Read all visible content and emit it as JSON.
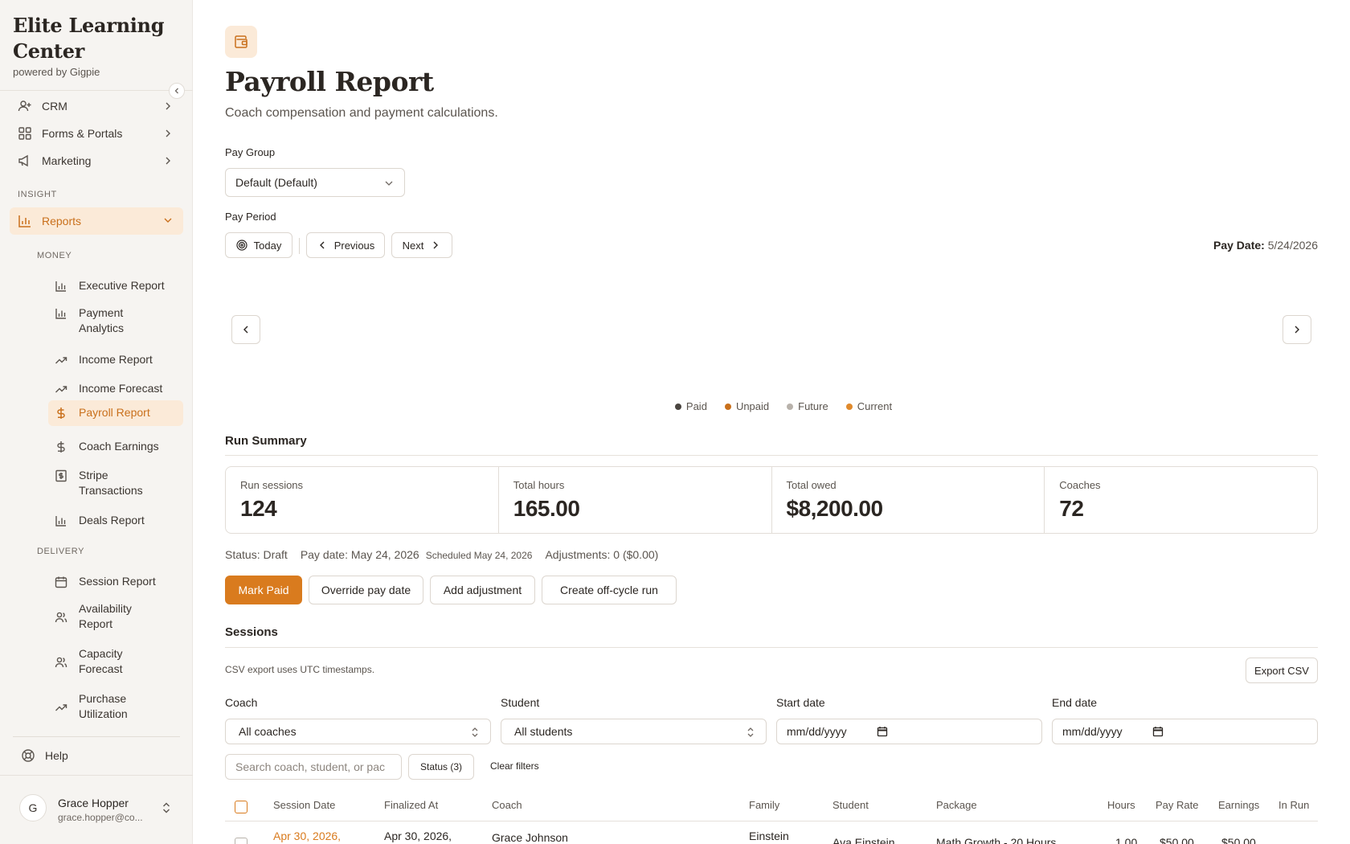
{
  "brand": {
    "title": "Elite Learning Center",
    "subtitle": "powered by Gigpie"
  },
  "nav": {
    "crm": "CRM",
    "forms": "Forms & Portals",
    "marketing": "Marketing",
    "insight_label": "INSIGHT",
    "reports": "Reports",
    "money_label": "MONEY",
    "money_items": [
      "Executive Report",
      "Payment Analytics",
      "Income Report",
      "Income Forecast",
      "Payroll Report",
      "Coach Earnings",
      "Stripe Transactions",
      "Deals Report"
    ],
    "delivery_label": "DELIVERY",
    "delivery_items": [
      "Session Report",
      "Availability Report",
      "Capacity Forecast",
      "Purchase Utilization"
    ],
    "help": "Help"
  },
  "user": {
    "initial": "G",
    "name": "Grace Hopper",
    "email": "grace.hopper@co..."
  },
  "header": {
    "title": "Payroll Report",
    "subtitle": "Coach compensation and payment calculations."
  },
  "pay_group": {
    "label": "Pay Group",
    "value": "Default (Default)"
  },
  "pay_period": {
    "label": "Pay Period",
    "today": "Today",
    "previous": "Previous",
    "next": "Next",
    "pay_date_label": "Pay Date:",
    "pay_date_value": "5/24/2026"
  },
  "legend": [
    {
      "label": "Paid",
      "color": "#4a4540"
    },
    {
      "label": "Unpaid",
      "color": "#c9701c"
    },
    {
      "label": "Future",
      "color": "#b8b2ab"
    },
    {
      "label": "Current",
      "color": "#e08a2c"
    }
  ],
  "run_summary": {
    "title": "Run Summary",
    "stats": [
      {
        "label": "Run sessions",
        "value": "124"
      },
      {
        "label": "Total hours",
        "value": "165.00"
      },
      {
        "label": "Total owed",
        "value": "$8,200.00"
      },
      {
        "label": "Coaches",
        "value": "72"
      }
    ],
    "status": "Status: Draft",
    "pay_date": "Pay date: May 24, 2026",
    "scheduled": "Scheduled May 24, 2026",
    "adjustments": "Adjustments: 0 ($0.00)",
    "actions": {
      "mark_paid": "Mark Paid",
      "override": "Override pay date",
      "add_adjustment": "Add adjustment",
      "off_cycle": "Create off-cycle run"
    }
  },
  "sessions": {
    "title": "Sessions",
    "csv_note": "CSV export uses UTC timestamps.",
    "export": "Export CSV",
    "filters": {
      "coach_label": "Coach",
      "coach_value": "All coaches",
      "student_label": "Student",
      "student_value": "All students",
      "start_label": "Start date",
      "start_placeholder": "mm/dd/yyyy",
      "end_label": "End date",
      "end_placeholder": "mm/dd/yyyy",
      "search_placeholder": "Search coach, student, or pac",
      "status": "Status (3)",
      "clear": "Clear filters"
    },
    "columns": [
      "Session Date",
      "Finalized At",
      "Coach",
      "Family",
      "Student",
      "Package",
      "Hours",
      "Pay Rate",
      "Earnings",
      "In Run"
    ],
    "rows": [
      {
        "session_date": "Apr 30, 2026,",
        "finalized_at": "Apr 30, 2026,",
        "coach": "Grace Johnson",
        "family": "Einstein",
        "student": "Ava Einstein",
        "package": "Math Growth - 20 Hours",
        "hours": "1.00",
        "pay_rate": "$50.00",
        "earnings": "$50.00"
      }
    ]
  }
}
